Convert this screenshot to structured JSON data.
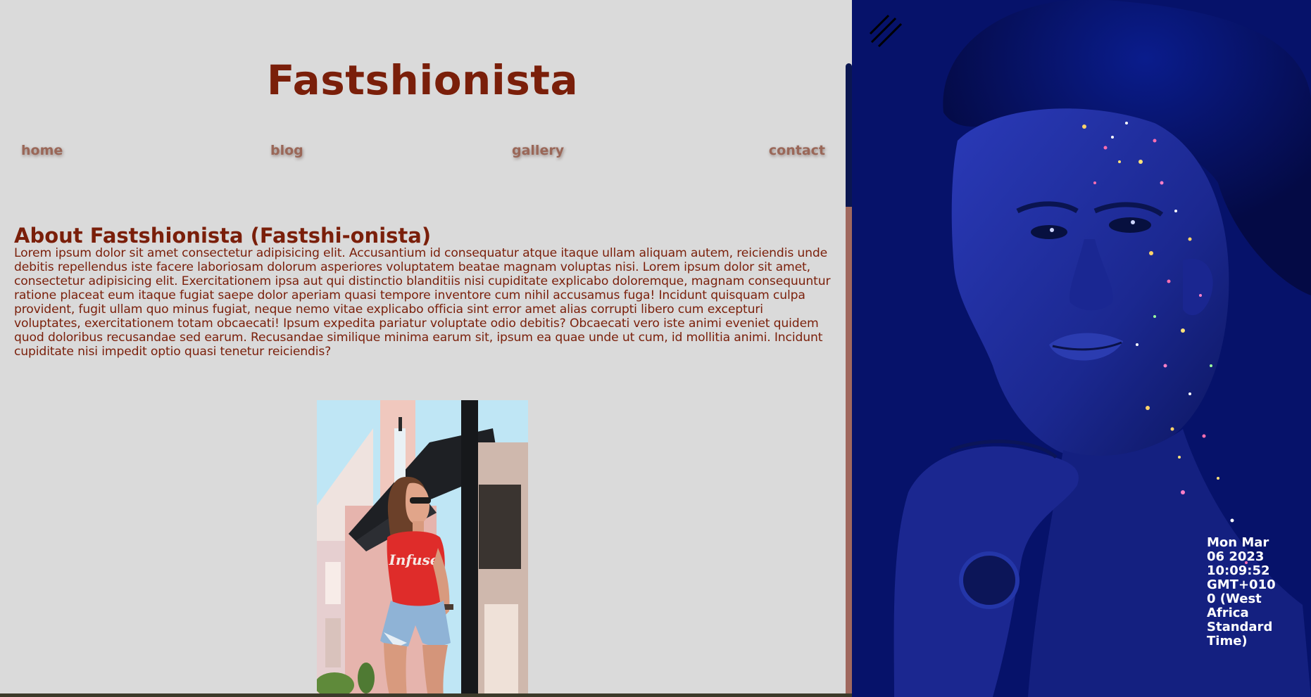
{
  "site": {
    "title": "Fastshionista"
  },
  "nav": {
    "items": [
      {
        "label": "home"
      },
      {
        "label": "blog"
      },
      {
        "label": "gallery"
      },
      {
        "label": "contact"
      }
    ]
  },
  "about": {
    "heading": "About Fastshionista (Fastshi-onista)",
    "body": "Lorem ipsum dolor sit amet consectetur adipisicing elit. Accusantium id consequatur atque itaque ullam aliquam autem, reiciendis unde debitis repellendus iste facere laboriosam dolorum asperiores voluptatem beatae magnam voluptas nisi. Lorem ipsum dolor sit amet, consectetur adipisicing elit. Exercitationem ipsa aut qui distinctio blanditiis nisi cupiditate explicabo doloremque, magnam consequuntur ratione placeat eum itaque fugiat saepe dolor aperiam quasi tempore inventore cum nihil accusamus fuga! Incidunt quisquam culpa provident, fugit ullam quo minus fugiat, neque nemo vitae explicabo officia sint error amet alias corrupti libero cum excepturi voluptates, exercitationem totam obcaecati! Ipsum expedita pariatur voluptate odio debitis? Obcaecati vero iste animi eveniet quidem quod doloribus recusandae sed earum. Recusandae similique minima earum sit, ipsum ea quae unde ut cum, id mollitia animi. Incidunt cupiditate nisi impedit optio quasi tenetur reiciendis?"
  },
  "photo": {
    "shirt_text": "Infuse"
  },
  "hero": {
    "menu_icon": "menu-icon",
    "clock": "Mon Mar 06 2023 10:09:52 GMT+0100 (West Africa Standard Time)"
  },
  "colors": {
    "background": "#dadada",
    "title": "#7a1f0a",
    "nav_link": "#9a6758",
    "hero_blue": "#06126a",
    "scroll_thumb": "#0a1650"
  }
}
